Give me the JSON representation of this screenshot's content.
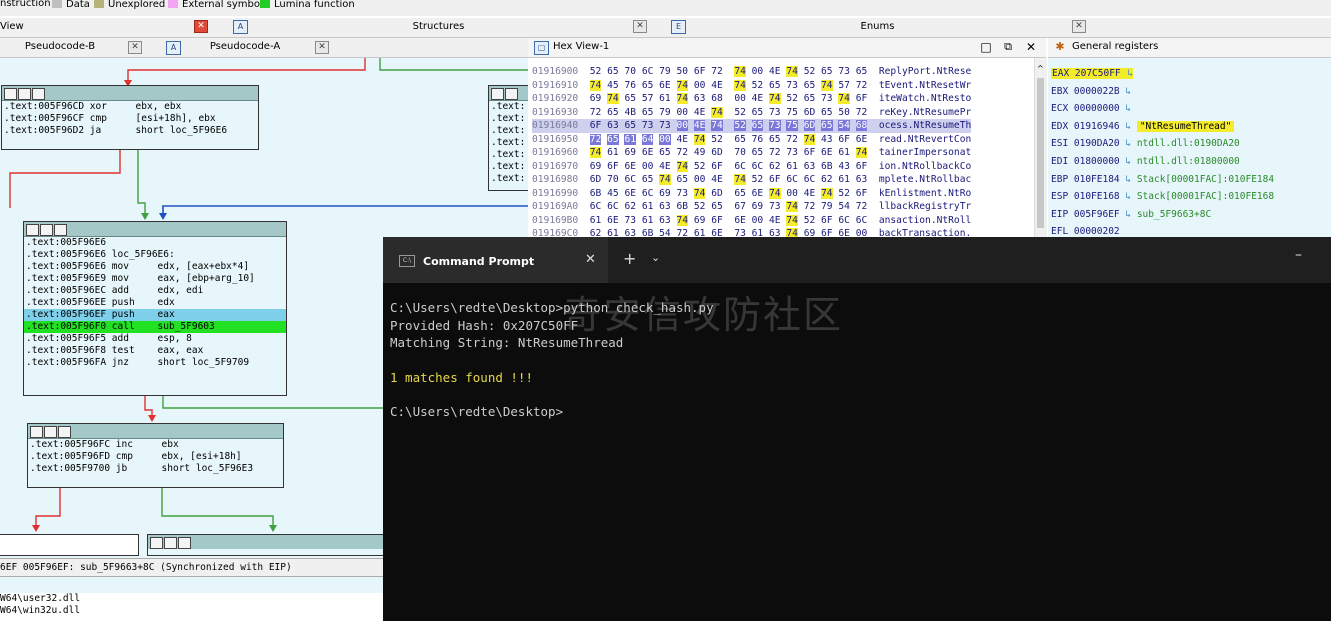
{
  "legend": {
    "items": [
      {
        "label": "nstruction",
        "color": ""
      },
      {
        "label": "Data",
        "color": "#c0c0c0"
      },
      {
        "label": "Unexplored",
        "color": "#b4b478"
      },
      {
        "label": "External symbol",
        "color": "#f4a4f4"
      },
      {
        "label": "Lumina function",
        "color": "#22cc22"
      }
    ]
  },
  "top_tabs": {
    "view_label": "View",
    "structures_label": "Structures",
    "enums_label": "Enums"
  },
  "pseudo_tabs": {
    "pseudo_b": "Pseudocode-B",
    "pseudo_a": "Pseudocode-A"
  },
  "hex_view": {
    "title": "Hex View-1",
    "rows": [
      {
        "addr": "01916900",
        "bytes": [
          "52",
          "65",
          "70",
          "6C",
          "79",
          "50",
          "6F",
          "72",
          "74",
          "00",
          "4E",
          "74",
          "52",
          "65",
          "73",
          "65"
        ],
        "ascii": "ReplyPort.NtRese"
      },
      {
        "addr": "01916910",
        "bytes": [
          "74",
          "45",
          "76",
          "65",
          "6E",
          "74",
          "00",
          "4E",
          "74",
          "52",
          "65",
          "73",
          "65",
          "74",
          "57",
          "72"
        ],
        "ascii": "tEvent.NtResetWr"
      },
      {
        "addr": "01916920",
        "bytes": [
          "69",
          "74",
          "65",
          "57",
          "61",
          "74",
          "63",
          "68",
          "00",
          "4E",
          "74",
          "52",
          "65",
          "73",
          "74",
          "6F"
        ],
        "ascii": "iteWatch.NtResto"
      },
      {
        "addr": "01916930",
        "bytes": [
          "72",
          "65",
          "4B",
          "65",
          "79",
          "00",
          "4E",
          "74",
          "52",
          "65",
          "73",
          "75",
          "6D",
          "65",
          "50",
          "72"
        ],
        "ascii": "reKey.NtResumePr"
      },
      {
        "addr": "01916940",
        "bytes": [
          "6F",
          "63",
          "65",
          "73",
          "73",
          "00",
          "4E",
          "74",
          "52",
          "65",
          "73",
          "75",
          "6D",
          "65",
          "54",
          "68"
        ],
        "ascii": "ocess.NtResumeTh"
      },
      {
        "addr": "01916950",
        "bytes": [
          "72",
          "65",
          "61",
          "64",
          "00",
          "4E",
          "74",
          "52",
          "65",
          "76",
          "65",
          "72",
          "74",
          "43",
          "6F",
          "6E"
        ],
        "ascii": "read.NtRevertCon"
      },
      {
        "addr": "01916960",
        "bytes": [
          "74",
          "61",
          "69",
          "6E",
          "65",
          "72",
          "49",
          "6D",
          "70",
          "65",
          "72",
          "73",
          "6F",
          "6E",
          "61",
          "74"
        ],
        "ascii": "tainerImpersonat"
      },
      {
        "addr": "01916970",
        "bytes": [
          "69",
          "6F",
          "6E",
          "00",
          "4E",
          "74",
          "52",
          "6F",
          "6C",
          "6C",
          "62",
          "61",
          "63",
          "6B",
          "43",
          "6F"
        ],
        "ascii": "ion.NtRollbackCo"
      },
      {
        "addr": "01916980",
        "bytes": [
          "6D",
          "70",
          "6C",
          "65",
          "74",
          "65",
          "00",
          "4E",
          "74",
          "52",
          "6F",
          "6C",
          "6C",
          "62",
          "61",
          "63"
        ],
        "ascii": "mplete.NtRollbac"
      },
      {
        "addr": "01916990",
        "bytes": [
          "6B",
          "45",
          "6E",
          "6C",
          "69",
          "73",
          "74",
          "6D",
          "65",
          "6E",
          "74",
          "00",
          "4E",
          "74",
          "52",
          "6F"
        ],
        "ascii": "kEnlistment.NtRo"
      },
      {
        "addr": "019169A0",
        "bytes": [
          "6C",
          "6C",
          "62",
          "61",
          "63",
          "6B",
          "52",
          "65",
          "67",
          "69",
          "73",
          "74",
          "72",
          "79",
          "54",
          "72"
        ],
        "ascii": "llbackRegistryTr"
      },
      {
        "addr": "019169B0",
        "bytes": [
          "61",
          "6E",
          "73",
          "61",
          "63",
          "74",
          "69",
          "6F",
          "6E",
          "00",
          "4E",
          "74",
          "52",
          "6F",
          "6C",
          "6C"
        ],
        "ascii": "ansaction.NtRoll"
      },
      {
        "addr": "019169C0",
        "bytes": [
          "62",
          "61",
          "63",
          "6B",
          "54",
          "72",
          "61",
          "6E",
          "73",
          "61",
          "63",
          "74",
          "69",
          "6F",
          "6E",
          "00"
        ],
        "ascii": "backTransaction."
      }
    ]
  },
  "registers": {
    "title": "General registers",
    "items": [
      {
        "name": "EAX",
        "value": "207C50FF",
        "target": ""
      },
      {
        "name": "EBX",
        "value": "0000022B",
        "target": ""
      },
      {
        "name": "ECX",
        "value": "00000000",
        "target": ""
      },
      {
        "name": "EDX",
        "value": "01916946",
        "target": "\"NtResumeThread\""
      },
      {
        "name": "ESI",
        "value": "0190DA20",
        "target": "ntdll.dll:0190DA20"
      },
      {
        "name": "EDI",
        "value": "01800000",
        "target": "ntdll.dll:01800000"
      },
      {
        "name": "EBP",
        "value": "010FE184",
        "target": "Stack[00001FAC]:010FE184"
      },
      {
        "name": "ESP",
        "value": "010FE168",
        "target": "Stack[00001FAC]:010FE168"
      },
      {
        "name": "EIP",
        "value": "005F96EF",
        "target": "sub_5F9663+8C"
      },
      {
        "name": "EFL",
        "value": "00000202",
        "target": ""
      }
    ]
  },
  "graph": {
    "node1": [
      ".text:005F96CD xor     ebx, ebx",
      ".text:005F96CF cmp     [esi+18h], ebx",
      ".text:005F96D2 ja      short loc_5F96E6"
    ],
    "node2": [
      ".text:005F96E6",
      ".text:005F96E6 loc_5F96E6:",
      ".text:005F96E6 mov     edx, [eax+ebx*4]",
      ".text:005F96E9 mov     eax, [ebp+arg_10]",
      ".text:005F96EC add     edx, edi",
      ".text:005F96EE push    edx",
      ".text:005F96EF push    eax",
      ".text:005F96F0 call    sub_5F9603",
      ".text:005F96F5 add     esp, 8",
      ".text:005F96F8 test    eax, eax",
      ".text:005F96FA jnz     short loc_5F9709"
    ],
    "node3": [
      ".text:005F96FC inc     ebx",
      ".text:005F96FD cmp     ebx, [esi+18h]",
      ".text:005F9700 jb      short loc_5F96E3"
    ],
    "node_r": [
      ".text:",
      ".text:",
      ".text:",
      ".text:",
      ".text:",
      ".text:",
      ".text:",
      ".text:",
      ".text:"
    ]
  },
  "cmd": {
    "title": "Command Prompt",
    "lines": [
      "C:\\Users\\redte\\Desktop>python check_hash.py",
      "Provided Hash: 0x207C50FF",
      "Matching String: NtResumeThread",
      "",
      "1 matches found !!!",
      "",
      "C:\\Users\\redte\\Desktop>"
    ],
    "watermark": "奇安信攻防社区"
  },
  "status": {
    "text": "6EF 005F96EF: sub_5F9663+8C (Synchronized with EIP)"
  },
  "output": {
    "lines": [
      "W64\\user32.dll",
      "W64\\win32u.dll"
    ]
  },
  "colors": {
    "graph_bg": "#e6f6fa",
    "node_header": "#a4c8c8",
    "cmd_bg": "#0c0c0c",
    "yellow_highlight": "#f4ec2a"
  }
}
